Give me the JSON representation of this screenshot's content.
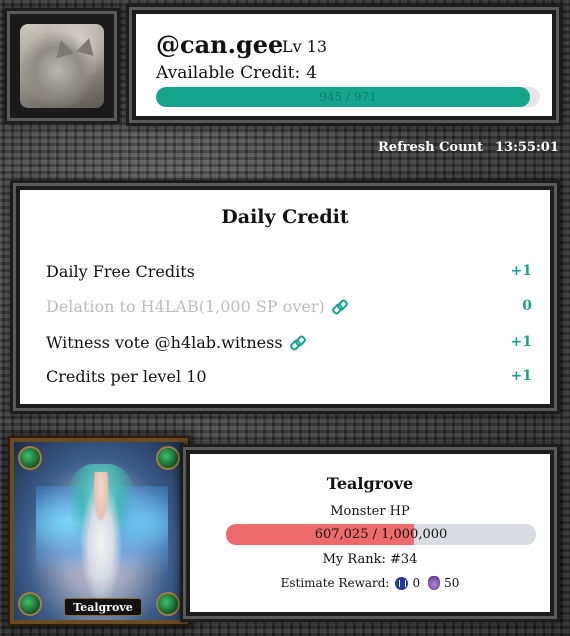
{
  "profile": {
    "username": "@can.gee",
    "level": "Lv 13",
    "credit_label": "Available Credit:",
    "credit_value": "4",
    "progress_text": "945 / 971",
    "progress_fraction": 0.973
  },
  "refresh": {
    "label": "Refresh Count",
    "time": "13:55:01"
  },
  "daily_credit": {
    "title": "Daily Credit",
    "rows": [
      {
        "label": "Daily Free Credits",
        "value": "+1",
        "has_link": false,
        "dimmed": false
      },
      {
        "label": "Delation to H4LAB(1,000 SP over)",
        "value": "0",
        "has_link": true,
        "dimmed": true
      },
      {
        "label": "Witness vote @h4lab.witness",
        "value": "+1",
        "has_link": true,
        "dimmed": false
      },
      {
        "label": "Credits per level 10",
        "value": "+1",
        "has_link": false,
        "dimmed": false
      }
    ]
  },
  "monster": {
    "card_name": "Tealgrove",
    "name": "Tealgrove",
    "hp_label": "Monster HP",
    "hp_text": "607,025 / 1,000,000",
    "hp_fraction": 0.607,
    "rank_text": "My Rank: #34",
    "reward_label": "Estimate Reward:",
    "reward_coin": "0",
    "reward_potion": "50"
  },
  "colors": {
    "accent": "#15a58f",
    "hp": "#ef6b6b"
  }
}
